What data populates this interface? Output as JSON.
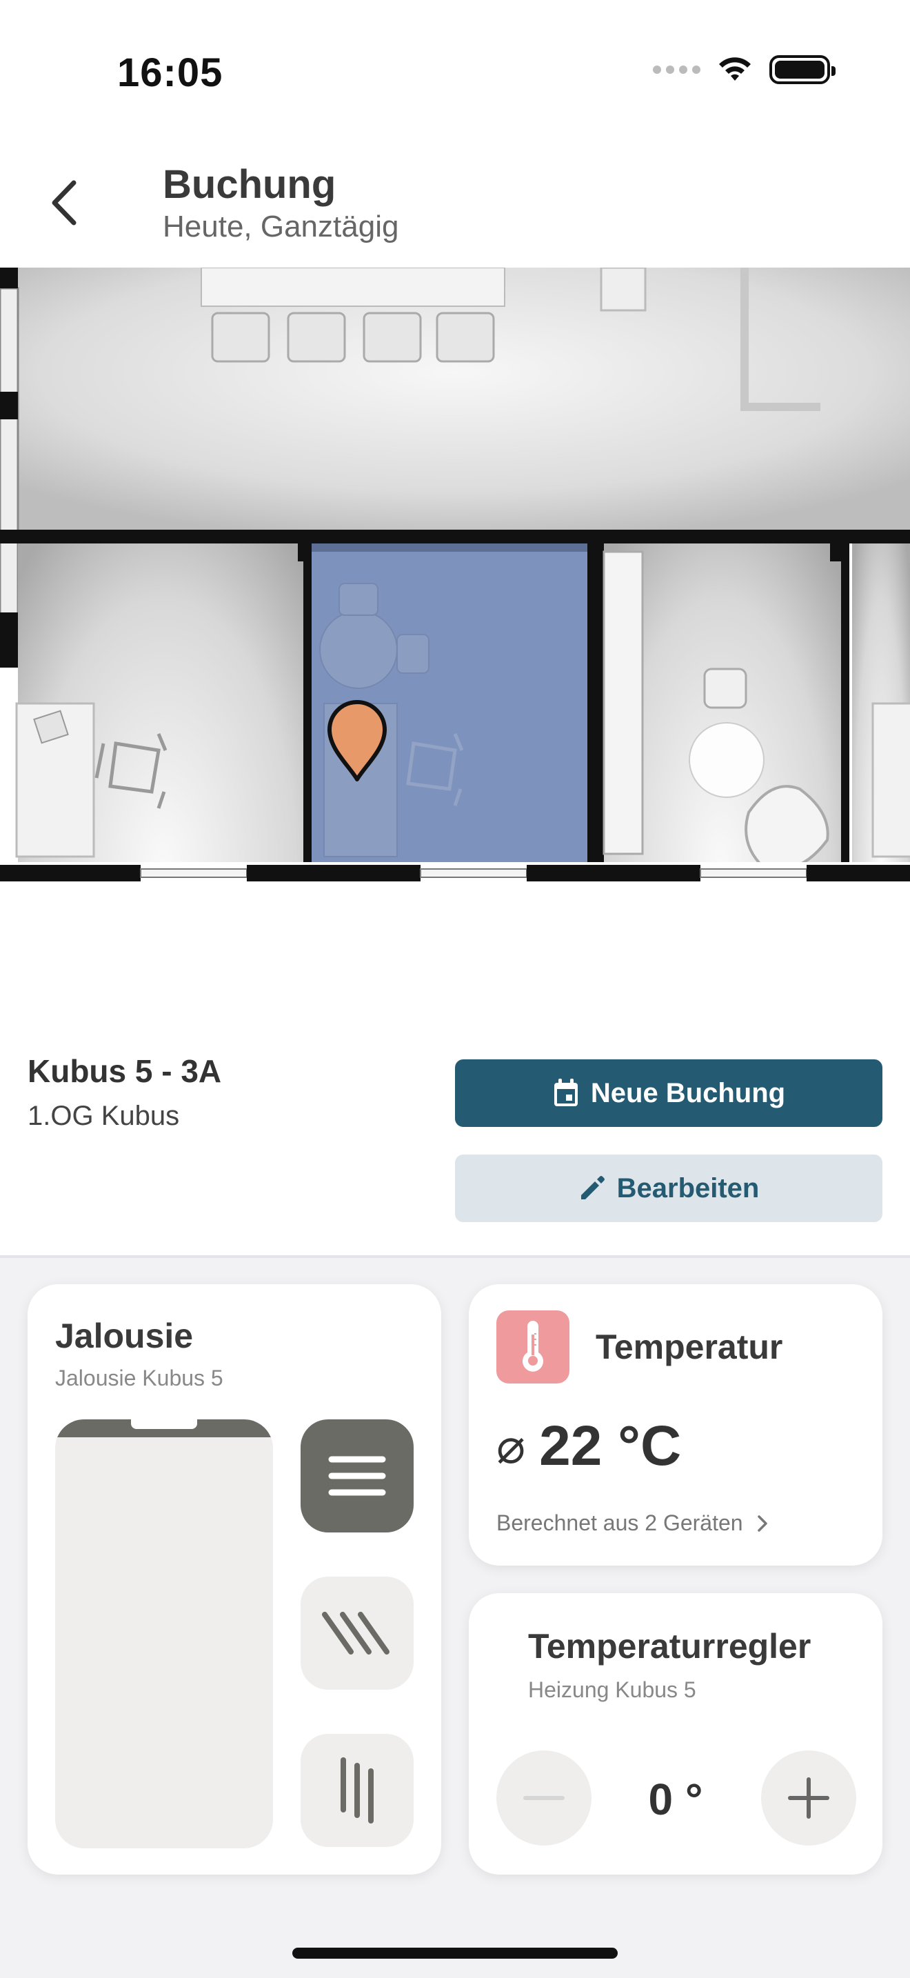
{
  "status_bar": {
    "time": "16:05"
  },
  "header": {
    "title": "Buchung",
    "subtitle": "Heute, Ganztägig"
  },
  "booking": {
    "room_name": "Kubus 5 - 3A",
    "room_location": "1.OG Kubus",
    "new_booking_label": "Neue Buchung",
    "edit_label": "Bearbeiten"
  },
  "jalousie": {
    "title": "Jalousie",
    "subtitle": "Jalousie Kubus 5",
    "selected_mode": "closed"
  },
  "temperature": {
    "title": "Temperatur",
    "value": "22 °C",
    "average_symbol": "⌀",
    "source_link": "Berechnet aus 2 Geräten"
  },
  "thermostat": {
    "title": "Temperaturregler",
    "subtitle": "Heizung Kubus 5",
    "setpoint": "0 °"
  },
  "colors": {
    "primary": "#245a72",
    "secondary_bg": "#dde5ea",
    "room_highlight": "#7d92bc",
    "pin": "#e8996a",
    "temp_icon_bg": "#ef9a9c",
    "blind_active": "#6b6b65"
  }
}
